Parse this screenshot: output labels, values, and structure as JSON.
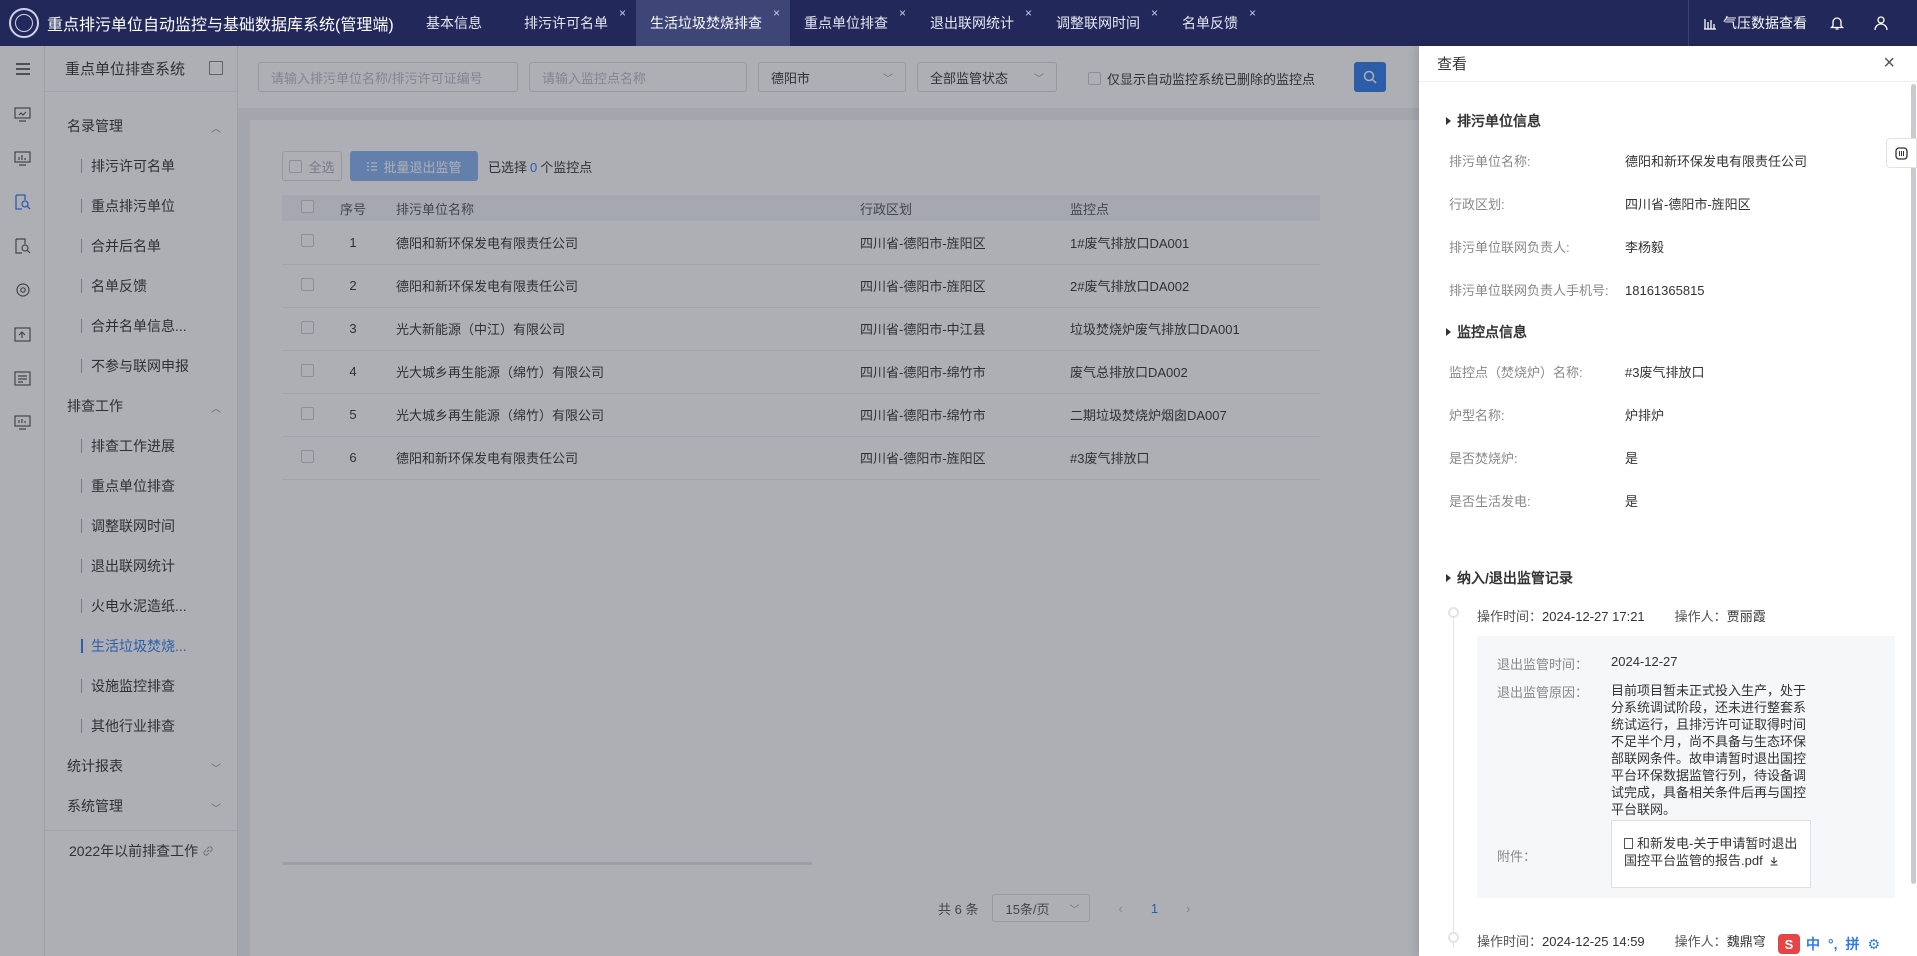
{
  "header": {
    "app_title": "重点排污单位自动监控与基础数据库系统(管理端)",
    "tabs": [
      {
        "label": "基本信息",
        "closable": false,
        "active": false
      },
      {
        "label": "排污许可名单",
        "closable": true,
        "active": false
      },
      {
        "label": "生活垃圾焚烧排查",
        "closable": true,
        "active": true
      },
      {
        "label": "重点单位排查",
        "closable": true,
        "active": false
      },
      {
        "label": "退出联网统计",
        "closable": true,
        "active": false
      },
      {
        "label": "调整联网时间",
        "closable": true,
        "active": false
      },
      {
        "label": "名单反馈",
        "closable": true,
        "active": false
      }
    ],
    "right_link": "气压数据查看",
    "close_symbol": "×"
  },
  "nav": {
    "title": "重点单位排查系统",
    "groups": [
      {
        "label": "名录管理",
        "expanded": true,
        "items": [
          "排污许可名单",
          "重点排污单位",
          "合并后名单",
          "名单反馈",
          "合并名单信息...",
          "不参与联网申报"
        ]
      },
      {
        "label": "排查工作",
        "expanded": true,
        "items": [
          "排查工作进展",
          "重点单位排查",
          "调整联网时间",
          "退出联网统计",
          "火电水泥造纸...",
          "生活垃圾焚烧...",
          "设施监控排查",
          "其他行业排查"
        ]
      },
      {
        "label": "统计报表",
        "expanded": false,
        "items": []
      },
      {
        "label": "系统管理",
        "expanded": false,
        "items": []
      }
    ],
    "active_item": "生活垃圾焚烧...",
    "footer_link": "2022年以前排查工作"
  },
  "filters": {
    "unit_placeholder": "请输入排污单位名称/排污许可证编号",
    "point_placeholder": "请输入监控点名称",
    "city_value": "德阳市",
    "status_value": "全部监管状态",
    "deleted_checkbox_label": "仅显示自动监控系统已删除的监控点"
  },
  "toolbar": {
    "select_all": "全选",
    "batch_exit": "批量退出监管",
    "selected_prefix": "已选择",
    "selected_count": "0",
    "selected_suffix": "个监控点"
  },
  "table": {
    "columns": [
      "序号",
      "排污单位名称",
      "行政区划",
      "监控点"
    ],
    "rows": [
      {
        "no": "1",
        "unit": "德阳和新环保发电有限责任公司",
        "region": "四川省-德阳市-旌阳区",
        "point": "1#废气排放口DA001"
      },
      {
        "no": "2",
        "unit": "德阳和新环保发电有限责任公司",
        "region": "四川省-德阳市-旌阳区",
        "point": "2#废气排放口DA002"
      },
      {
        "no": "3",
        "unit": "光大新能源（中江）有限公司",
        "region": "四川省-德阳市-中江县",
        "point": "垃圾焚烧炉废气排放口DA001"
      },
      {
        "no": "4",
        "unit": "光大城乡再生能源（绵竹）有限公司",
        "region": "四川省-德阳市-绵竹市",
        "point": "废气总排放口DA002"
      },
      {
        "no": "5",
        "unit": "光大城乡再生能源（绵竹）有限公司",
        "region": "四川省-德阳市-绵竹市",
        "point": "二期垃圾焚烧炉烟囱DA007"
      },
      {
        "no": "6",
        "unit": "德阳和新环保发电有限责任公司",
        "region": "四川省-德阳市-旌阳区",
        "point": "#3废气排放口"
      }
    ]
  },
  "pagination": {
    "total": "共 6 条",
    "page_size": "15条/页",
    "current": "1",
    "prev": "‹",
    "next": "›"
  },
  "drawer": {
    "title": "查看",
    "unit_section": "排污单位信息",
    "unit_fields": [
      {
        "k": "排污单位名称:",
        "v": "德阳和新环保发电有限责任公司"
      },
      {
        "k": "行政区划:",
        "v": "四川省-德阳市-旌阳区"
      },
      {
        "k": "排污单位联网负责人:",
        "v": "李杨毅"
      },
      {
        "k": "排污单位联网负责人手机号:",
        "v": "18161365815"
      }
    ],
    "point_section": "监控点信息",
    "point_fields": [
      {
        "k": "监控点（焚烧炉）名称:",
        "v": "#3废气排放口"
      },
      {
        "k": "炉型名称:",
        "v": "炉排炉"
      },
      {
        "k": "是否焚烧炉:",
        "v": "是"
      },
      {
        "k": "是否生活发电:",
        "v": "是"
      }
    ],
    "record_section": "纳入/退出监管记录",
    "records": [
      {
        "time_label": "操作时间：",
        "time": "2024-12-27 17:21",
        "op_label": "操作人：",
        "operator": "贾丽霞"
      },
      {
        "time_label": "操作时间：",
        "time": "2024-12-25 14:59",
        "op_label": "操作人：",
        "operator": "魏鼎穹"
      }
    ],
    "record_detail": {
      "exit_time_label": "退出监管时间：",
      "exit_time": "2024-12-27",
      "reason_label": "退出监管原因：",
      "reason": "目前项目暂未正式投入生产，处于分系统调试阶段，还未进行整套系统试运行，且排污许可证取得时间不足半个月，尚不具备与生态环保部联网条件。故申请暂时退出国控平台环保数据监管行列，待设备调试完成，具备相关条件后再与国控平台联网。",
      "attach_label": "附件：",
      "attach_file": "和新发电-关于申请暂时退出国控平台监管的报告.pdf"
    }
  },
  "ime": {
    "lang": "中",
    "punct": "°,",
    "mode": "拼"
  },
  "colors": {
    "topbar": "#22295a",
    "active_tab": "#3d4677",
    "accent": "#2f7bea",
    "overlay": "rgba(40,44,60,0.38)"
  }
}
